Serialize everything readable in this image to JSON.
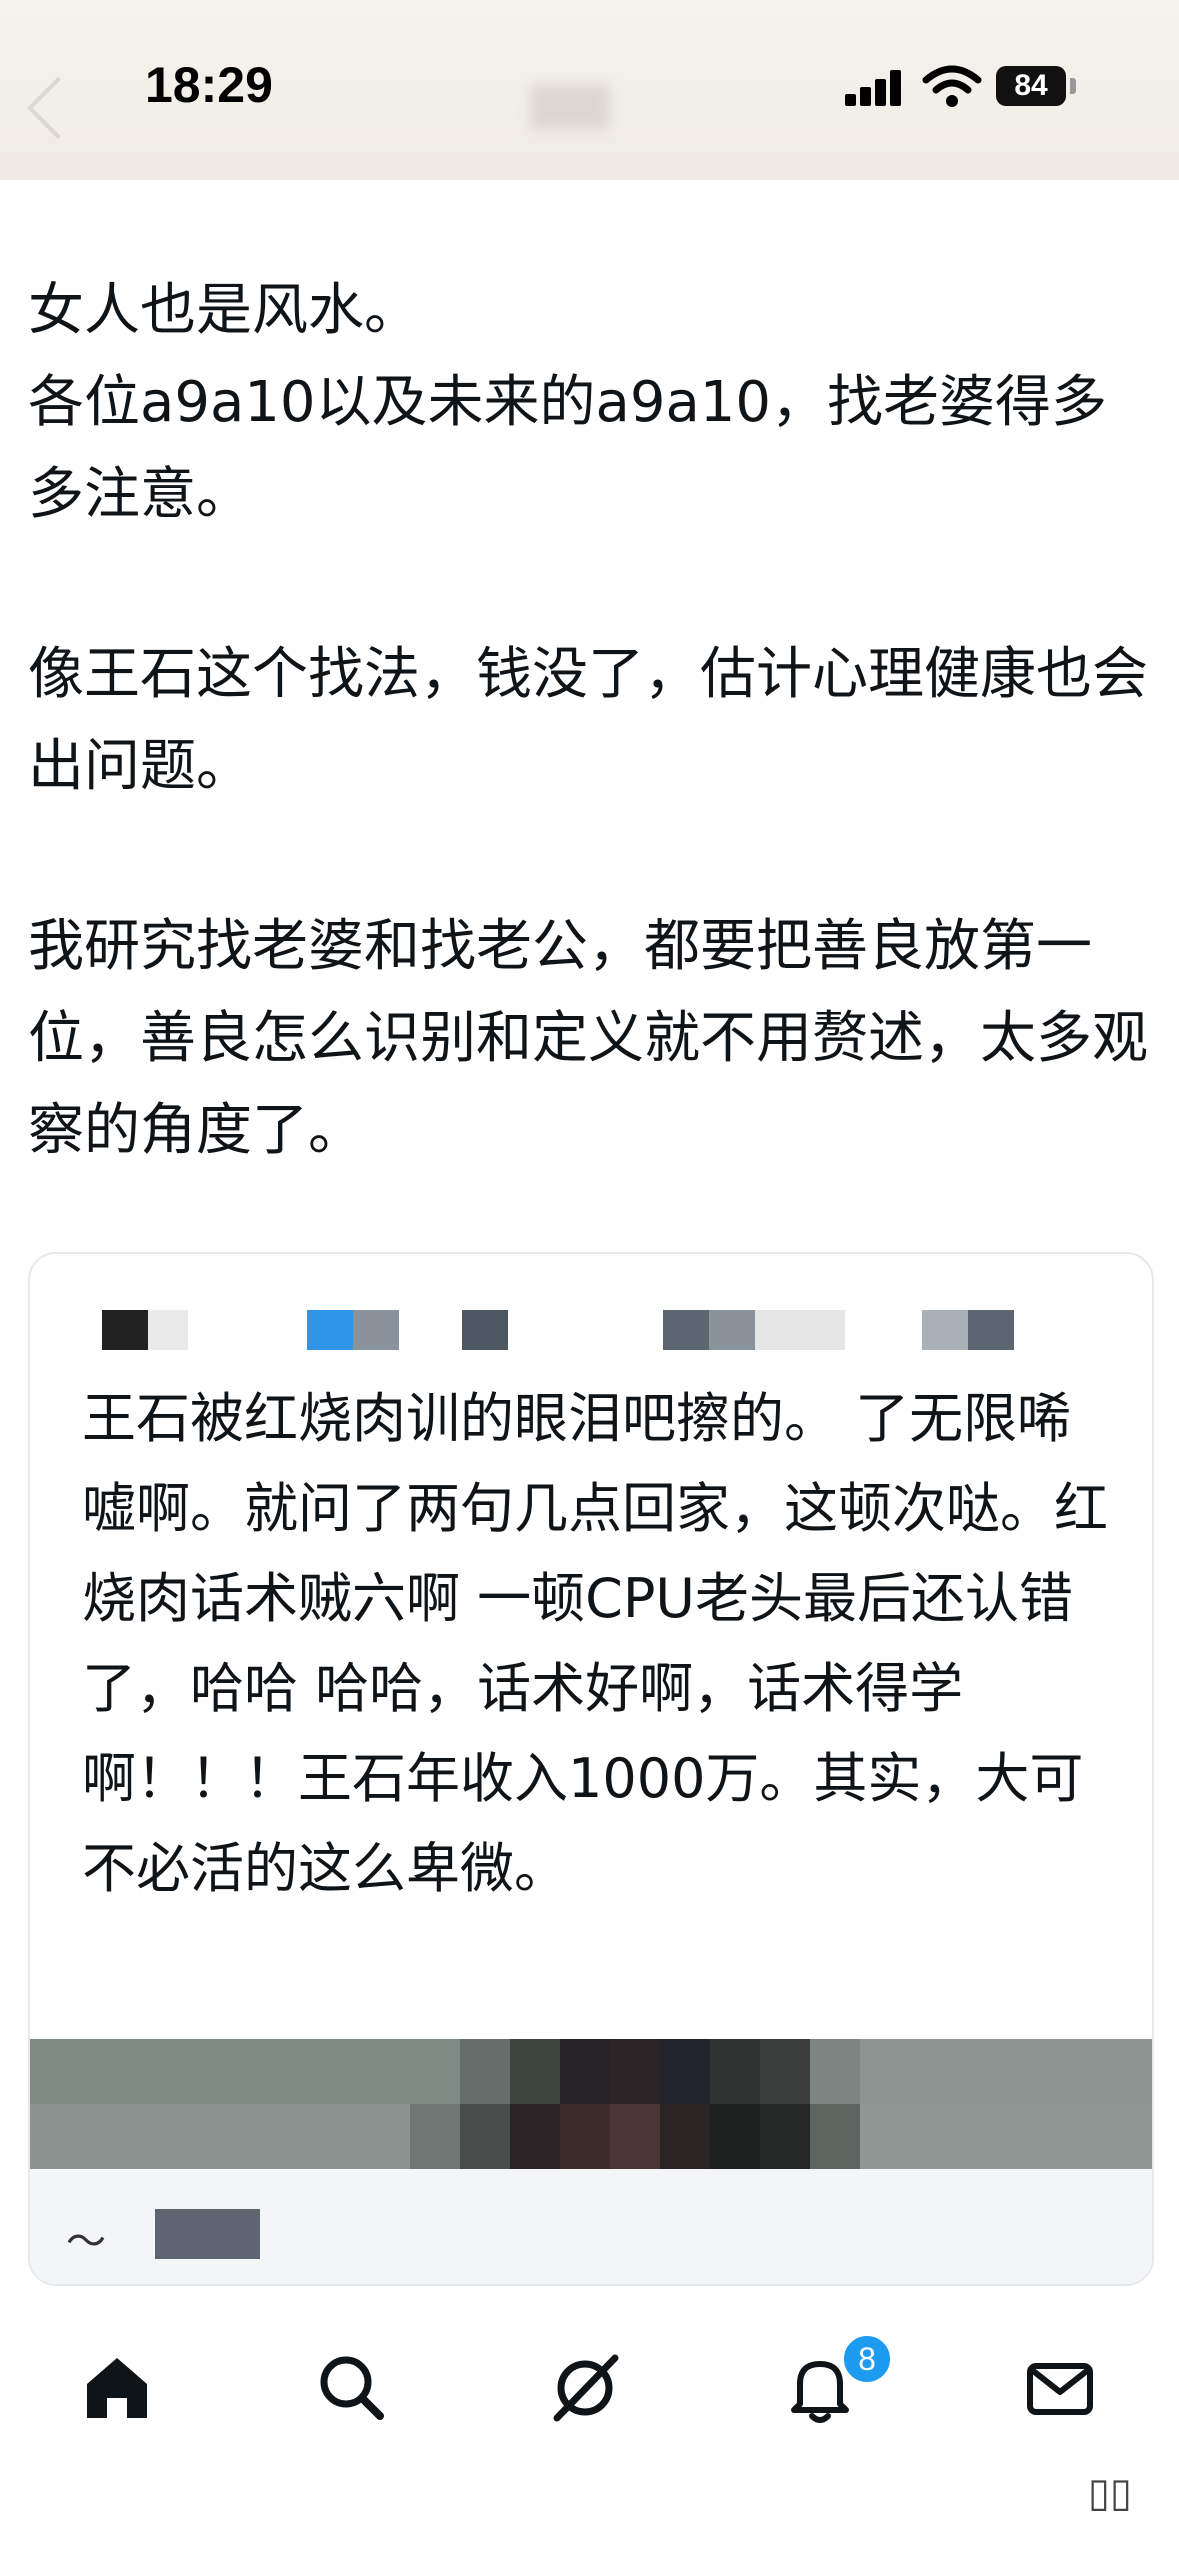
{
  "status_bar": {
    "time": "18:29",
    "battery": "84"
  },
  "post": {
    "paragraphs": [
      "女人也是风水。",
      "各位a9a10以及未来的a9a10，找老婆得多多注意。",
      "",
      "像王石这个找法，钱没了，估计心理健康也会出问题。",
      "",
      "我研究找老婆和找老公，都要把善良放第一位，善良怎么识别和定义就不用赘述，太多观察的角度了。"
    ]
  },
  "quote": {
    "text": "王石被红烧肉训的眼泪吧擦的。 了无限唏嘘啊。就问了两句几点回家，这顿次哒。红烧肉话术贼六啊 一顿CPU老头最后还认错了，哈哈 哈哈，话术好啊，话术得学啊！！！王石年收入1000万。其实，大可不必活的这么卑微。",
    "footer_mark": "〜"
  },
  "nav": {
    "notification_count": "8",
    "icons": [
      "home-icon",
      "search-icon",
      "grok-icon",
      "bell-icon",
      "mail-icon"
    ]
  },
  "colors": {
    "accent": "#1d9bf0",
    "text": "#0f1419",
    "border": "#e6e9ec"
  }
}
